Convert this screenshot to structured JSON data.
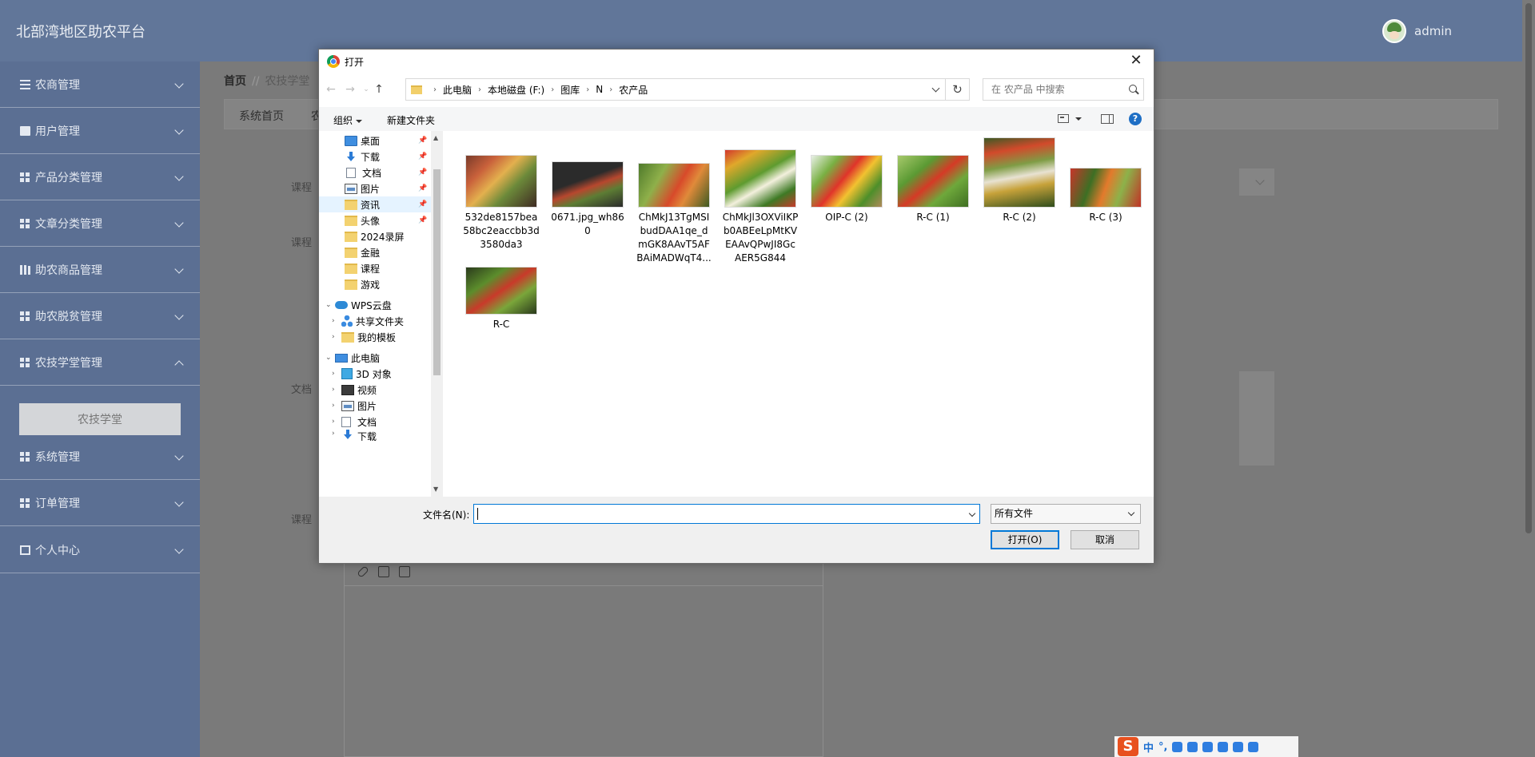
{
  "app": {
    "site_title": "北部湾地区助农平台",
    "username": "admin",
    "menu": [
      {
        "label": "农商管理",
        "icon": "list-icon"
      },
      {
        "label": "用户管理",
        "icon": "briefcase-icon"
      },
      {
        "label": "产品分类管理",
        "icon": "grid-icon"
      },
      {
        "label": "文章分类管理",
        "icon": "grid-icon"
      },
      {
        "label": "助农商品管理",
        "icon": "books-icon"
      },
      {
        "label": "助农脱贫管理",
        "icon": "grid-icon"
      },
      {
        "label": "农技学堂管理",
        "icon": "grid-icon"
      },
      {
        "label": "系统管理",
        "icon": "grid-icon"
      },
      {
        "label": "订单管理",
        "icon": "grid-icon"
      },
      {
        "label": "个人中心",
        "icon": "box-icon"
      }
    ],
    "submenu_active": "农技学堂",
    "breadcrumb": {
      "home": "首页",
      "sep": "//",
      "current": "农技学堂"
    },
    "tabs": [
      "系统首页",
      "农"
    ],
    "form_labels": [
      "课程",
      "课程",
      "文档",
      "课程"
    ]
  },
  "dialog": {
    "title": "打开",
    "close": "✕",
    "path": [
      "此电脑",
      "本地磁盘 (F:)",
      "图库",
      "N",
      "农产品"
    ],
    "search_placeholder": "在 农产品 中搜索",
    "toolbar": {
      "organize": "组织",
      "new_folder": "新建文件夹"
    },
    "nav_tree": [
      {
        "label": "桌面",
        "icon": "desktop-icon",
        "pinned": true
      },
      {
        "label": "下载",
        "icon": "download-icon",
        "pinned": true
      },
      {
        "label": "文档",
        "icon": "document-icon",
        "pinned": true
      },
      {
        "label": "图片",
        "icon": "picture-icon",
        "pinned": true
      },
      {
        "label": "资讯",
        "icon": "folder-icon",
        "pinned": true
      },
      {
        "label": "头像",
        "icon": "folder-icon",
        "pinned": true
      },
      {
        "label": "2024录屏",
        "icon": "folder-icon"
      },
      {
        "label": "金融",
        "icon": "folder-icon"
      },
      {
        "label": "课程",
        "icon": "folder-icon"
      },
      {
        "label": "游戏",
        "icon": "folder-icon"
      },
      {
        "label": "WPS云盘",
        "icon": "cloud-icon",
        "expanded": true
      },
      {
        "label": "共享文件夹",
        "icon": "share-icon"
      },
      {
        "label": "我的模板",
        "icon": "folder-icon"
      },
      {
        "label": "此电脑",
        "icon": "computer-icon",
        "expanded": true
      },
      {
        "label": "3D 对象",
        "icon": "cube-icon"
      },
      {
        "label": "视频",
        "icon": "video-icon"
      },
      {
        "label": "图片",
        "icon": "picture-icon"
      },
      {
        "label": "文档",
        "icon": "document-icon"
      },
      {
        "label": "下载",
        "icon": "download-icon"
      }
    ],
    "files": [
      {
        "name": "532de8157bea58bc2eaccbb3d3580da3"
      },
      {
        "name": "0671.jpg_wh860"
      },
      {
        "name": "ChMkJ13TgMSIbudDAA1qe_dmGK8AAvT5AFBAiMADWqT4..."
      },
      {
        "name": "ChMkJl3OXViIKPb0ABEeLpMtKVEAAvQPwJI8GcAER5G844"
      },
      {
        "name": "OIP-C (2)"
      },
      {
        "name": "R-C (1)"
      },
      {
        "name": "R-C (2)"
      },
      {
        "name": "R-C (3)"
      },
      {
        "name": "R-C"
      }
    ],
    "filename_label": "文件名(N):",
    "filename_value": "",
    "file_type": "所有文件",
    "open_label": "打开(O)",
    "cancel_label": "取消"
  },
  "ime": {
    "logo": "S",
    "mode": "中",
    "punct": "°,"
  }
}
